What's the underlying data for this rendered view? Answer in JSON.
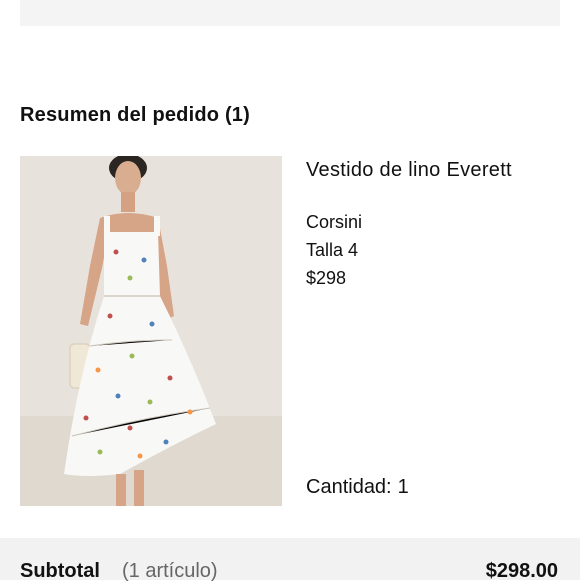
{
  "order_summary": {
    "title": "Resumen del pedido (1)",
    "item": {
      "name": "Vestido de lino Everett",
      "color": "Corsini",
      "size": "Talla 4",
      "price": "$298",
      "quantity_label": "Cantidad:",
      "quantity_value": "1",
      "image_icon": "product-photo"
    }
  },
  "subtotal": {
    "label": "Subtotal",
    "count": "(1 artículo)",
    "amount": "$298.00"
  },
  "colors": {
    "image_background": "#e7e2db",
    "panel_background": "#f2f2f2"
  }
}
